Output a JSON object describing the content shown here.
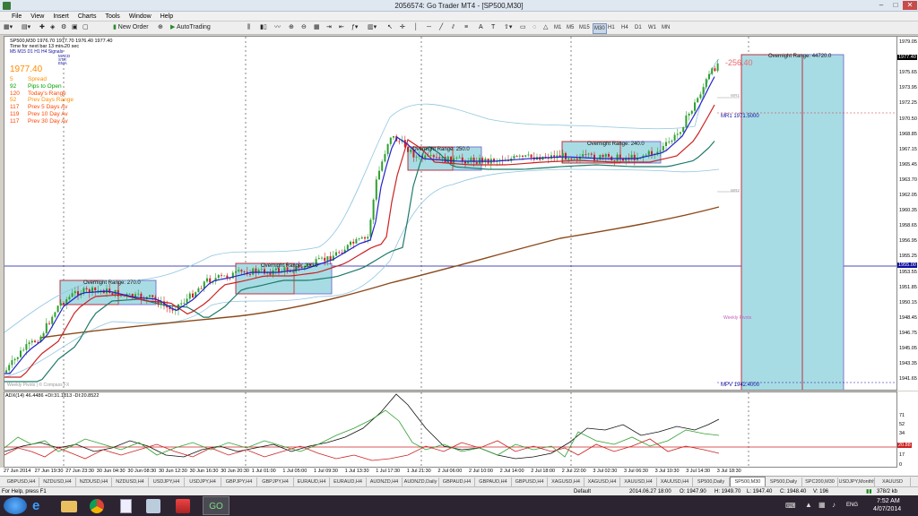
{
  "window": {
    "title": "2056574: Go Trader MT4 - [SP500,M30]"
  },
  "menu": [
    "File",
    "View",
    "Insert",
    "Charts",
    "Tools",
    "Window",
    "Help"
  ],
  "toolbar": {
    "new_order": "New Order",
    "autotrading": "AutoTrading",
    "timeframes": [
      "M1",
      "M5",
      "M15",
      "M30",
      "H1",
      "H4",
      "D1",
      "W1",
      "MN"
    ]
  },
  "chart": {
    "symbol_line": "SP500,M30  1976.70 1977.70 1976.40 1977.40",
    "timer": "Time for next bar 13 min 20 sec",
    "tf_legend": "M5 M15 D1 H1 H4  Signals",
    "legend_names": [
      "MACD",
      "STR",
      "EMA"
    ],
    "price": "1977.40",
    "info_rows": [
      {
        "value": "5",
        "label": "Spread",
        "color": "#ff8c00"
      },
      {
        "value": "92",
        "label": "Pips to Open",
        "color": "#00a000"
      },
      {
        "value": "120",
        "label": "Today's Range",
        "color": "#ff4500"
      },
      {
        "value": "52",
        "label": "Prev Days Range",
        "color": "#ff8c00"
      },
      {
        "value": "117",
        "label": "Prev 5 Days Av",
        "color": "#ff4500"
      },
      {
        "value": "119",
        "label": "Prev 10 Day Av",
        "color": "#ff4500"
      },
      {
        "value": "117",
        "label": "Prev 30 Day Av",
        "color": "#ff4500"
      }
    ],
    "overnight_boxes": [
      "Overnight Range: 270.0",
      "Overnight Range: 230.0",
      "Overnight Range: 250.0",
      "Overnight Range: 240.0",
      "Overnight Range: 44720.0"
    ],
    "countdown": "-256.40",
    "pivots": {
      "wr1": "WR1",
      "mr1": "MR1  1971.5000",
      "wr2": "WR2",
      "weekly": "Weekly Pivots",
      "mpv": "MPV  1942.4000"
    },
    "watermark": "Weekly Pivots | © Compass FX"
  },
  "yaxis": {
    "labels": [
      "1979.05",
      "1977.40",
      "1975.65",
      "1973.95",
      "1972.25",
      "1970.50",
      "1968.85",
      "1967.15",
      "1965.45",
      "1963.70",
      "1962.05",
      "1960.35",
      "1958.65",
      "1956.95",
      "1955.25",
      "1953.55",
      "1951.85",
      "1950.15",
      "1948.45",
      "1946.75",
      "1945.05",
      "1943.35",
      "1941.65"
    ],
    "hline_label": "1955.00"
  },
  "adx": {
    "label": "ADX(14) 46.4486 +DI:31.1813 -DI:20.8522",
    "ylabels": [
      "71",
      "52",
      "34",
      "20.88",
      "17",
      "0"
    ]
  },
  "xaxis": [
    "27 Jun 2014",
    "27 Jun 19:30",
    "27 Jun 23:30",
    "30 Jun 04:30",
    "30 Jun 08:30",
    "30 Jun 12:30",
    "30 Jun 16:30",
    "30 Jun 20:30",
    "1 Jul 01:00",
    "1 Jul 05:00",
    "1 Jul 09:30",
    "1 Jul 13:30",
    "1 Jul 17:30",
    "1 Jul 21:30",
    "2 Jul 06:00",
    "2 Jul 10:00",
    "2 Jul 14:00",
    "2 Jul 18:00",
    "2 Jul 22:00",
    "3 Jul 02:30",
    "3 Jul 06:30",
    "3 Jul 10:30",
    "3 Jul 14:30",
    "3 Jul 18:30"
  ],
  "tabs": [
    "GBPUSD,H4",
    "NZDUSD,H4",
    "NZDUSD,H4",
    "NZDUSD,H4",
    "USDJPY,H4",
    "USDJPY,H4",
    "GBPJPY,H4",
    "GBPJPY,H4",
    "EURAUD,H4",
    "EURAUD,H4",
    "AUDNZD,H4",
    "AUDNZD,Daily",
    "GBPAUD,H4",
    "GBPAUD,H4",
    "GBPUSD,H4",
    "XAGUSD,H4",
    "XAGUSD,H4",
    "XAUUSD,H4",
    "XAUUSD,H4",
    "SP500,Daily",
    "SP500,M30",
    "SP500,Daily",
    "SPC200,M30",
    "USDJPY,Monthly",
    "XAUUSD"
  ],
  "active_tab": "SP500,M30",
  "status": {
    "help": "For Help, press F1",
    "profile": "Default",
    "datetime": "2014.06.27 18:00",
    "open": "O: 1947.90",
    "high": "H: 1949.70",
    "low": "L: 1947.40",
    "close": "C: 1948.40",
    "volume": "V: 196",
    "traffic": "378/2 kb"
  },
  "taskbar": {
    "time": "7:52 AM",
    "date": "4/07/2014",
    "lang": "ENG"
  }
}
